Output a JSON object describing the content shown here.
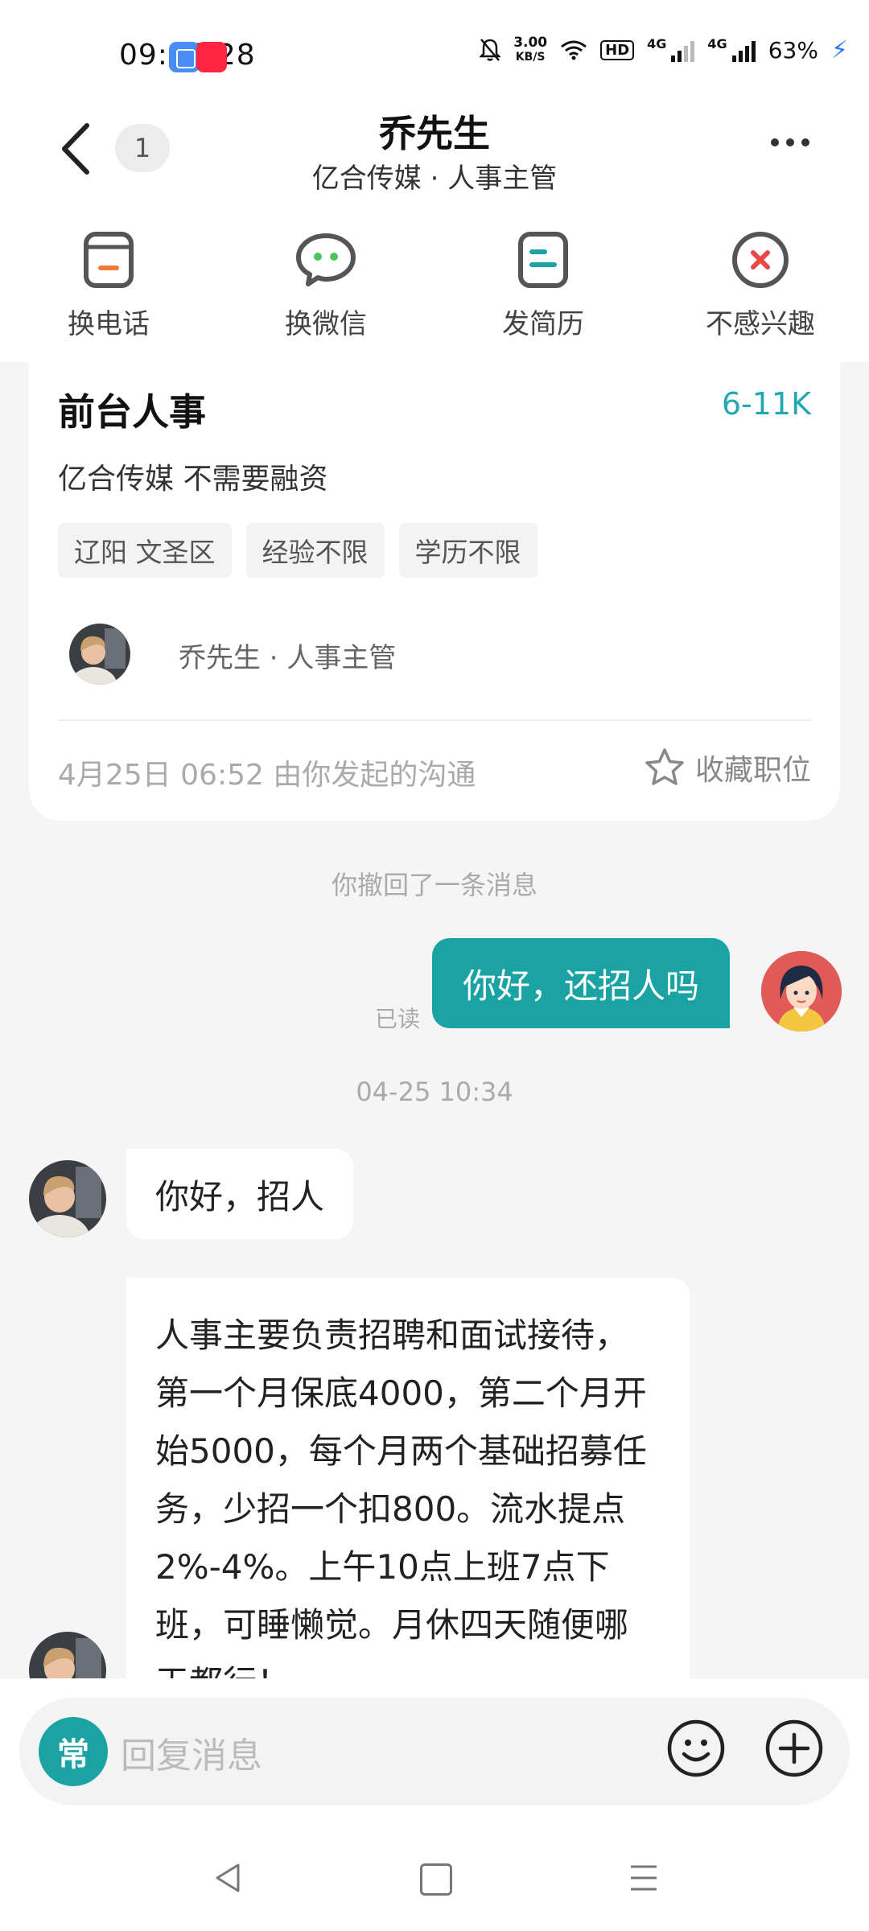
{
  "status_bar": {
    "time": "09:06:28",
    "net_speed_value": "3.00",
    "net_speed_unit": "KB/S",
    "hd_label": "HD",
    "network_label": "4G",
    "battery": "63%"
  },
  "header": {
    "unread_count": "1",
    "contact_name": "乔先生",
    "contact_subtitle": "亿合传媒 · 人事主管"
  },
  "actions": [
    {
      "label": "换电话",
      "icon": "phone-icon"
    },
    {
      "label": "换微信",
      "icon": "wechat-icon"
    },
    {
      "label": "发简历",
      "icon": "resume-icon"
    },
    {
      "label": "不感兴趣",
      "icon": "not-interested-icon"
    }
  ],
  "job": {
    "title": "前台人事",
    "salary": "6-11K",
    "company": "亿合传媒 不需要融资",
    "tags": [
      "辽阳 文圣区",
      "经验不限",
      "学历不限"
    ],
    "recruiter": "乔先生 · 人事主管",
    "meta": "4月25日 06:52 由你发起的沟通",
    "favorite_label": "收藏职位"
  },
  "chat": {
    "system_message": "你撤回了一条消息",
    "my_message": "你好，还招人吗",
    "read_status": "已读",
    "time_separator": "04-25 10:34",
    "reply1": "你好，招人",
    "reply2": "人事主要负责招聘和面试接待，第一个月保底4000，第二个月开始5000，每个月两个基础招募任务，少招一个扣800。流水提点2%-4%。上午10点上班7点下班，可睡懒觉。月休四天随便哪天都行！"
  },
  "input": {
    "quick_label": "常",
    "placeholder": "回复消息"
  },
  "colors": {
    "accent": "#1ba3a3",
    "salary": "#22a8b0",
    "bubble_me": "#1ba3a3"
  }
}
